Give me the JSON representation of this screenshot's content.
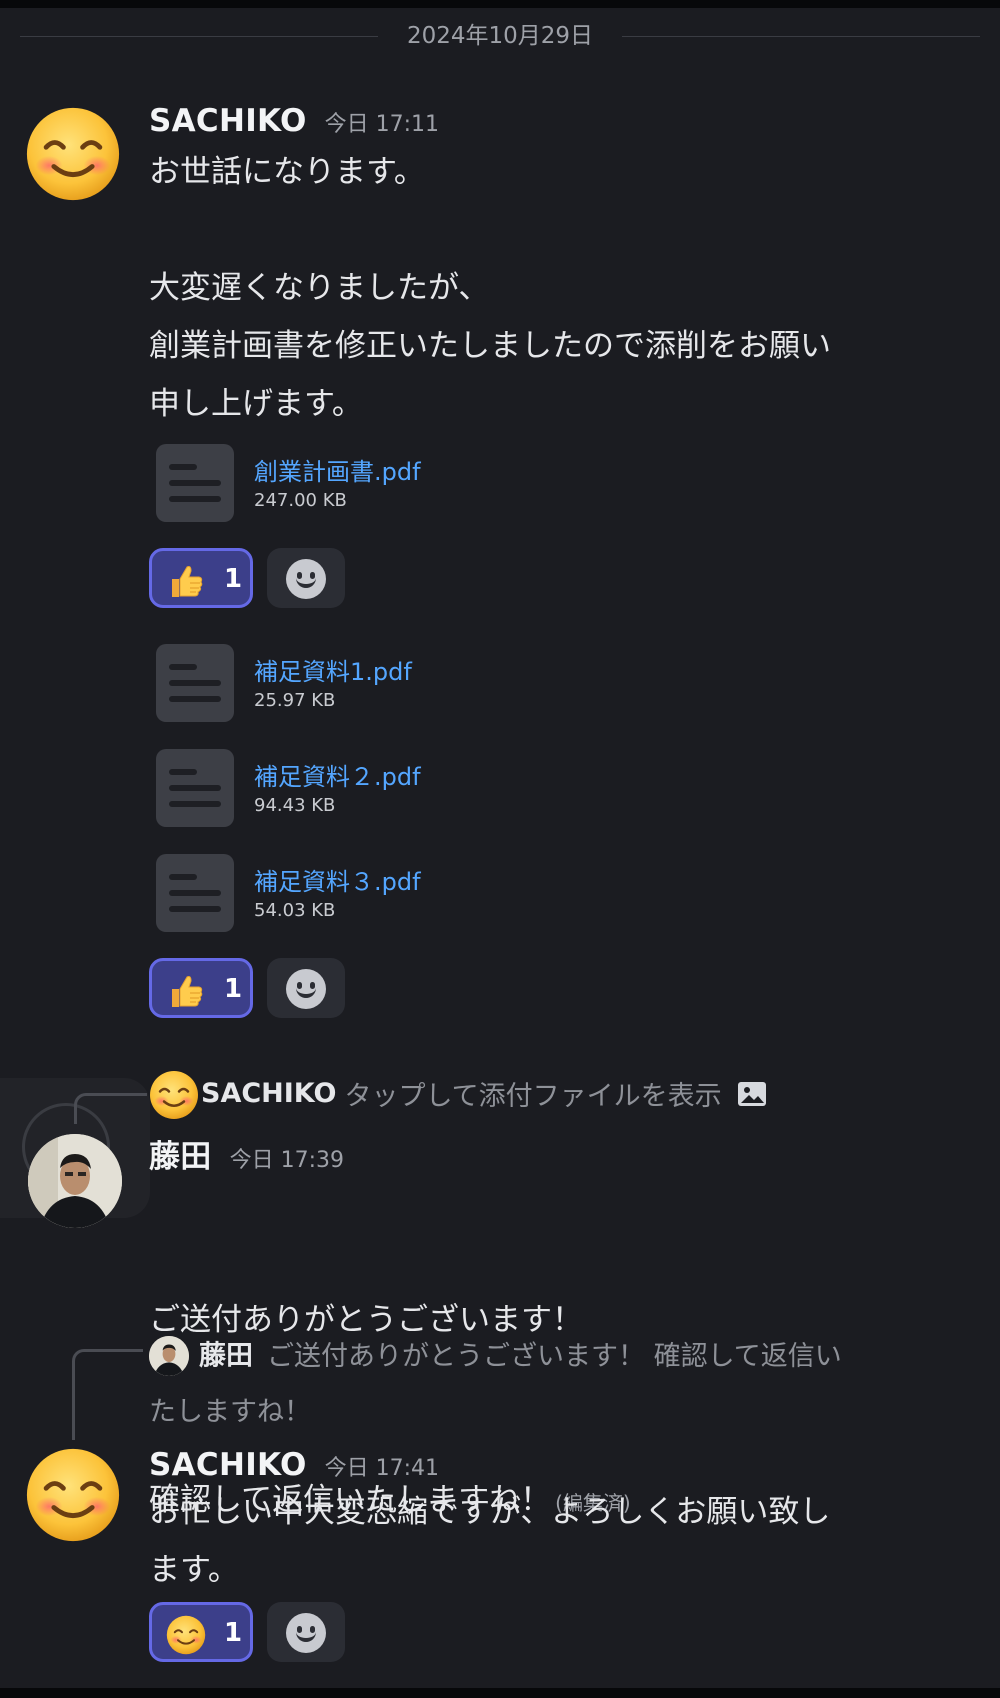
{
  "date_divider": "2024年10月29日",
  "messages": {
    "m1": {
      "author": "SACHIKO",
      "time": "今日 17:11",
      "text": "お世話になります。\n\n大変遅くなりましたが、\n創業計画書を修正いたしましたので添削をお願い\n申し上げます。",
      "avatar_icon": "smiling-face-emoji",
      "files": [
        {
          "name": "創業計画書.pdf",
          "size": "247.00 KB",
          "icon": "document-icon"
        }
      ],
      "reaction": {
        "emoji": "thumbs-up",
        "count": "1",
        "add_icon": "add-reaction-icon"
      }
    },
    "m2": {
      "files": [
        {
          "name": "補足資料1.pdf",
          "size": "25.97 KB",
          "icon": "document-icon"
        },
        {
          "name": "補足資料２.pdf",
          "size": "94.43 KB",
          "icon": "document-icon"
        },
        {
          "name": "補足資料３.pdf",
          "size": "54.03 KB",
          "icon": "document-icon"
        }
      ],
      "reaction": {
        "emoji": "thumbs-up",
        "count": "1",
        "add_icon": "add-reaction-icon"
      }
    },
    "m3": {
      "reply_to": {
        "author": "SACHIKO",
        "text": "タップして添付ファイルを表示",
        "icon": "image-icon"
      },
      "author": "藤田",
      "time": "今日 17:39",
      "line1": "ご送付ありがとうございます！",
      "line2": "確認して返信いたしますね！",
      "edited": "(編集済)",
      "avatar_icon": "person-photo"
    },
    "m4": {
      "reply_to": {
        "author": "藤田",
        "text_line1": "ご送付ありがとうございます！ 確認して返信い",
        "text_line2": "たしますね！"
      },
      "author": "SACHIKO",
      "time": "今日 17:41",
      "text": "お忙しい中大変恐縮ですが、よろしくお願い致し\nます。",
      "avatar_icon": "smiling-face-emoji",
      "reaction": {
        "emoji": "smiling-face",
        "count": "1",
        "add_icon": "add-reaction-icon"
      }
    }
  },
  "colors": {
    "background": "#1b1c21",
    "link": "#54a6ff",
    "reaction_active": "#3c3f8a",
    "reaction_border": "#6569e6"
  }
}
